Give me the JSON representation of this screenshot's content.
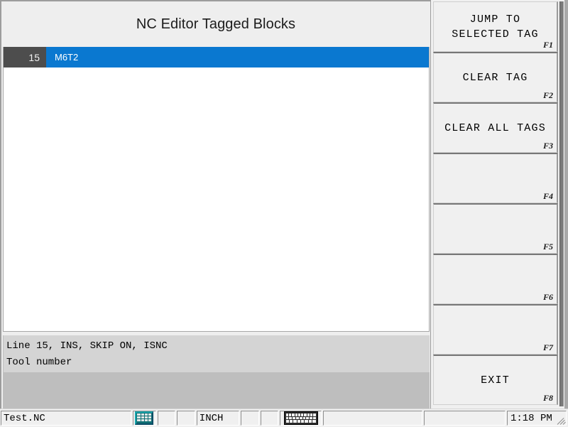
{
  "window": {
    "title": "NC Editor Tagged Blocks"
  },
  "tag_list": {
    "rows": [
      {
        "line_no": "15",
        "block_text": "M6T2"
      }
    ]
  },
  "info_panel": {
    "line1": "Line 15, INS, SKIP ON, ISNC",
    "line2": "Tool number"
  },
  "softkeys": [
    {
      "label": "JUMP TO\nSELECTED TAG",
      "fkey": "F1"
    },
    {
      "label": "CLEAR TAG",
      "fkey": "F2"
    },
    {
      "label": "CLEAR ALL TAGS",
      "fkey": "F3"
    },
    {
      "label": "",
      "fkey": "F4"
    },
    {
      "label": "",
      "fkey": "F5"
    },
    {
      "label": "",
      "fkey": "F6"
    },
    {
      "label": "",
      "fkey": "F7"
    },
    {
      "label": "EXIT",
      "fkey": "F8"
    }
  ],
  "status_bar": {
    "filename": "Test.NC",
    "calc_icon": "calculator-icon",
    "blank1": "",
    "blank2": "",
    "units": "INCH",
    "blank3": "",
    "blank4": "",
    "keyboard_icon": "keyboard-icon",
    "blank5": "",
    "blank6": "",
    "time": "1:18 PM"
  },
  "colors": {
    "selection_blue": "#0a78d0",
    "gutter_gray": "#4d4d4d",
    "header_gray": "#eeeeee",
    "info_light": "#d4d4d4",
    "info_dark": "#bebebe"
  }
}
